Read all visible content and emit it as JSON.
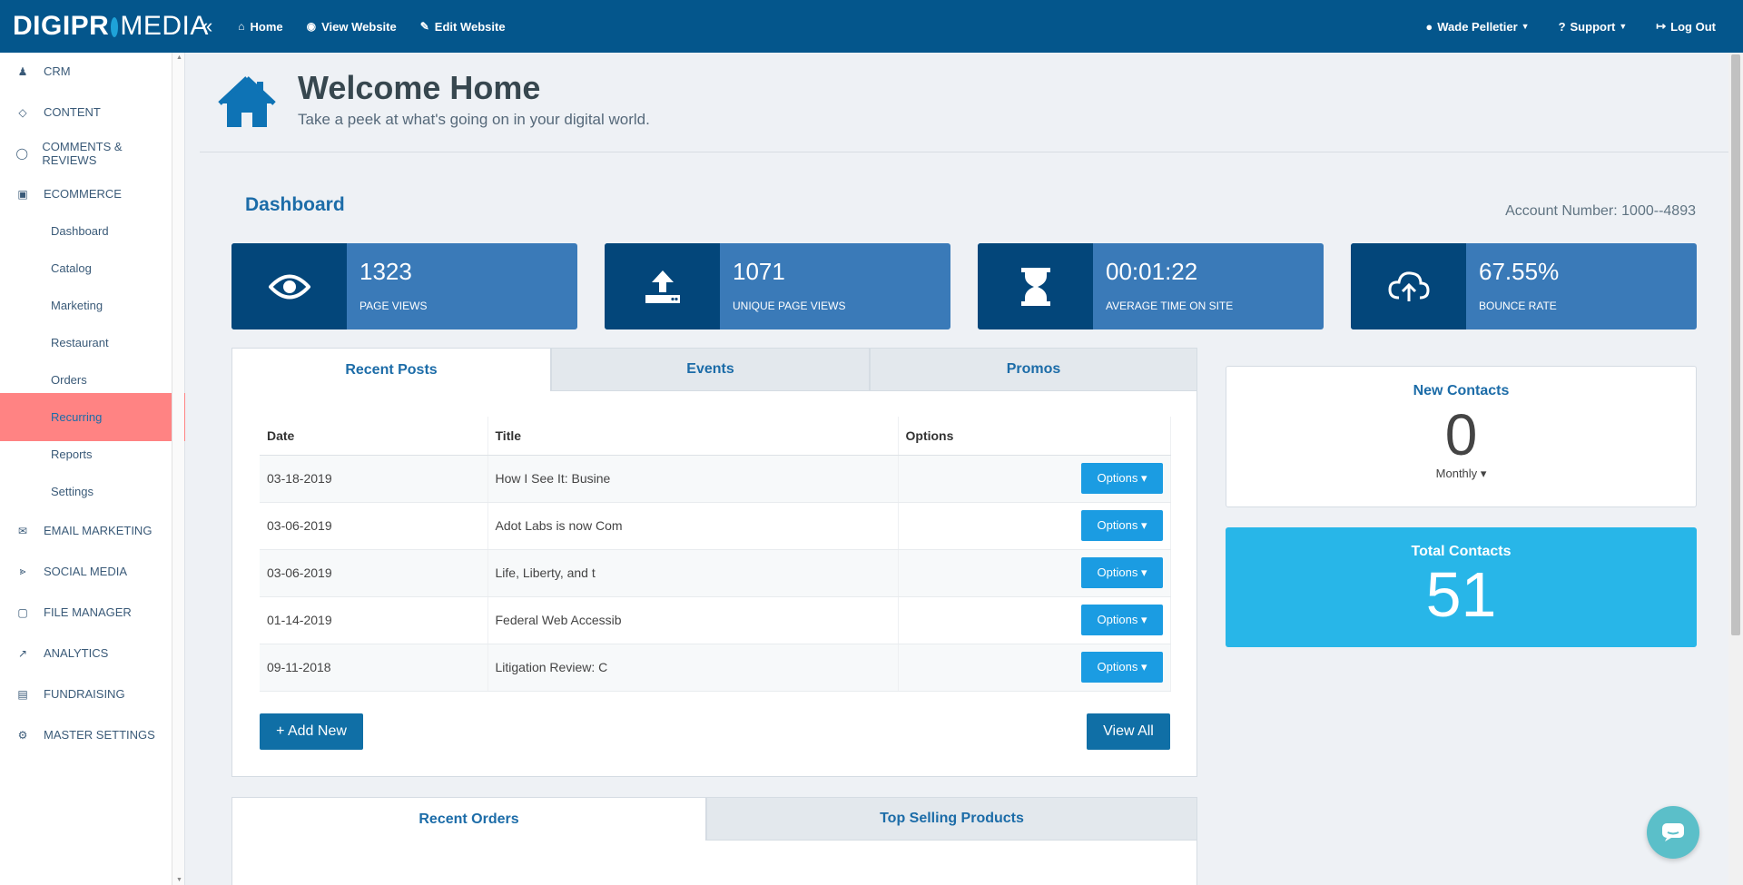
{
  "brand": {
    "logo_left": "DIGIPR",
    "logo_right": "MEDIA"
  },
  "topnav": {
    "collapse": "«",
    "home": "Home",
    "view_website": "View Website",
    "edit_website": "Edit Website",
    "user": "Wade Pelletier",
    "support": "Support",
    "logout": "Log Out"
  },
  "sidebar": {
    "items": [
      {
        "label": "CRM",
        "icon": "users-icon"
      },
      {
        "label": "CONTENT",
        "icon": "diamond-icon"
      },
      {
        "label": "COMMENTS & REVIEWS",
        "icon": "comment-icon"
      },
      {
        "label": "ECOMMERCE",
        "icon": "gift-icon"
      },
      {
        "label": "EMAIL MARKETING",
        "icon": "envelope-icon"
      },
      {
        "label": "SOCIAL MEDIA",
        "icon": "share-icon"
      },
      {
        "label": "FILE MANAGER",
        "icon": "folder-icon"
      },
      {
        "label": "ANALYTICS",
        "icon": "chart-icon"
      },
      {
        "label": "FUNDRAISING",
        "icon": "money-icon"
      },
      {
        "label": "MASTER SETTINGS",
        "icon": "gear-icon"
      }
    ],
    "ecommerce_sub": [
      "Dashboard",
      "Catalog",
      "Marketing",
      "Restaurant",
      "Orders",
      "Recurring",
      "Reports",
      "Settings"
    ]
  },
  "header": {
    "title": "Welcome Home",
    "subtitle": "Take a peek at what's going on in your digital world."
  },
  "dashboard": {
    "title": "Dashboard",
    "account": "Account Number: 1000--4893"
  },
  "stats": [
    {
      "value": "1323",
      "label": "PAGE VIEWS",
      "icon": "eye-icon"
    },
    {
      "value": "1071",
      "label": "UNIQUE PAGE VIEWS",
      "icon": "upload-icon"
    },
    {
      "value": "00:01:22",
      "label": "AVERAGE TIME ON SITE",
      "icon": "hourglass-icon"
    },
    {
      "value": "67.55%",
      "label": "BOUNCE RATE",
      "icon": "cloud-upload-icon"
    }
  ],
  "posts_tabs": [
    "Recent Posts",
    "Events",
    "Promos"
  ],
  "posts_table": {
    "headers": [
      "Date",
      "Title",
      "Options"
    ],
    "rows": [
      {
        "date": "03-18-2019",
        "title": "How I See It: Busine",
        "option": "Options"
      },
      {
        "date": "03-06-2019",
        "title": "Adot Labs is now Com",
        "option": "Options"
      },
      {
        "date": "03-06-2019",
        "title": "Life, Liberty, and t",
        "option": "Options"
      },
      {
        "date": "01-14-2019",
        "title": "Federal Web Accessib",
        "option": "Options"
      },
      {
        "date": "09-11-2018",
        "title": "Litigation Review: C",
        "option": "Options"
      }
    ],
    "add_new": "+ Add New",
    "view_all": "View All"
  },
  "new_contacts": {
    "title": "New Contacts",
    "count": "0",
    "period": "Monthly"
  },
  "total_contacts": {
    "title": "Total Contacts",
    "count": "51"
  },
  "orders_tabs": [
    "Recent Orders",
    "Top Selling Products"
  ],
  "colors": {
    "topbar": "#04568c",
    "stat_bg": "#3a7ab8",
    "stat_icon_bg": "#03467a",
    "accent": "#1b9ce2",
    "active_sub": "#ff8383",
    "total_contacts": "#28b6e8"
  }
}
